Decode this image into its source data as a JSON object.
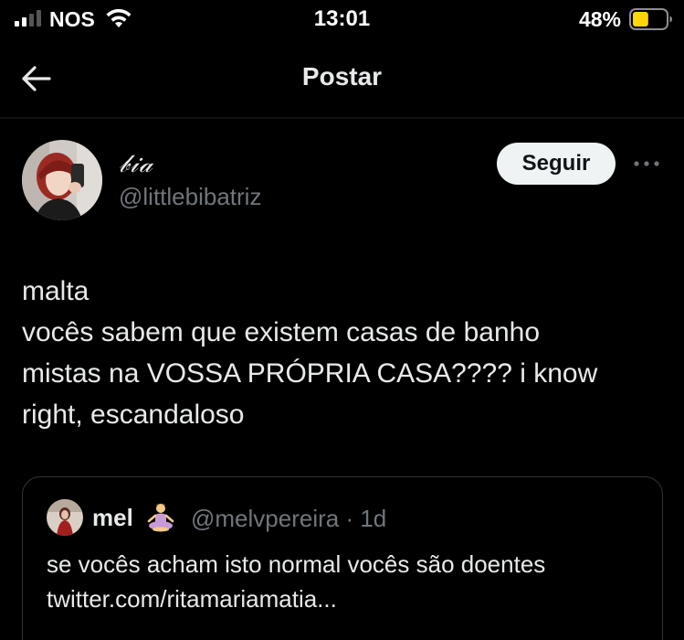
{
  "status_bar": {
    "carrier": "NOS",
    "time": "13:01",
    "battery_percent": "48%",
    "battery_level": 0.48,
    "battery_color": "#ffd60a",
    "icons": [
      "signal-icon",
      "wifi-icon",
      "battery-icon"
    ]
  },
  "header": {
    "title": "Postar",
    "back_icon": "arrow-left-icon"
  },
  "post": {
    "author": {
      "display_name": "𝒷𝒾𝒶",
      "handle": "@littlebibatriz"
    },
    "follow_label": "Seguir",
    "more_icon": "more-horizontal-icon",
    "text_lines": [
      "malta",
      "vocês sabem que existem casas de banho",
      "mistas na VOSSA PRÓPRIA CASA???? i know",
      "right, escandaloso"
    ]
  },
  "quoted_post": {
    "display_name": "mel",
    "emoji_icon": "person-in-lotus-position-icon",
    "handle_time": "@melvpereira · 1d",
    "text_lines": [
      "se vocês acham isto normal vocês são doentes",
      "twitter.com/ritamariamatia..."
    ]
  },
  "colors": {
    "background": "#000000",
    "primary_text": "#e7e9ea",
    "secondary_text": "#71767b",
    "border": "#2f3336",
    "follow_button_bg": "#eff3f4"
  }
}
